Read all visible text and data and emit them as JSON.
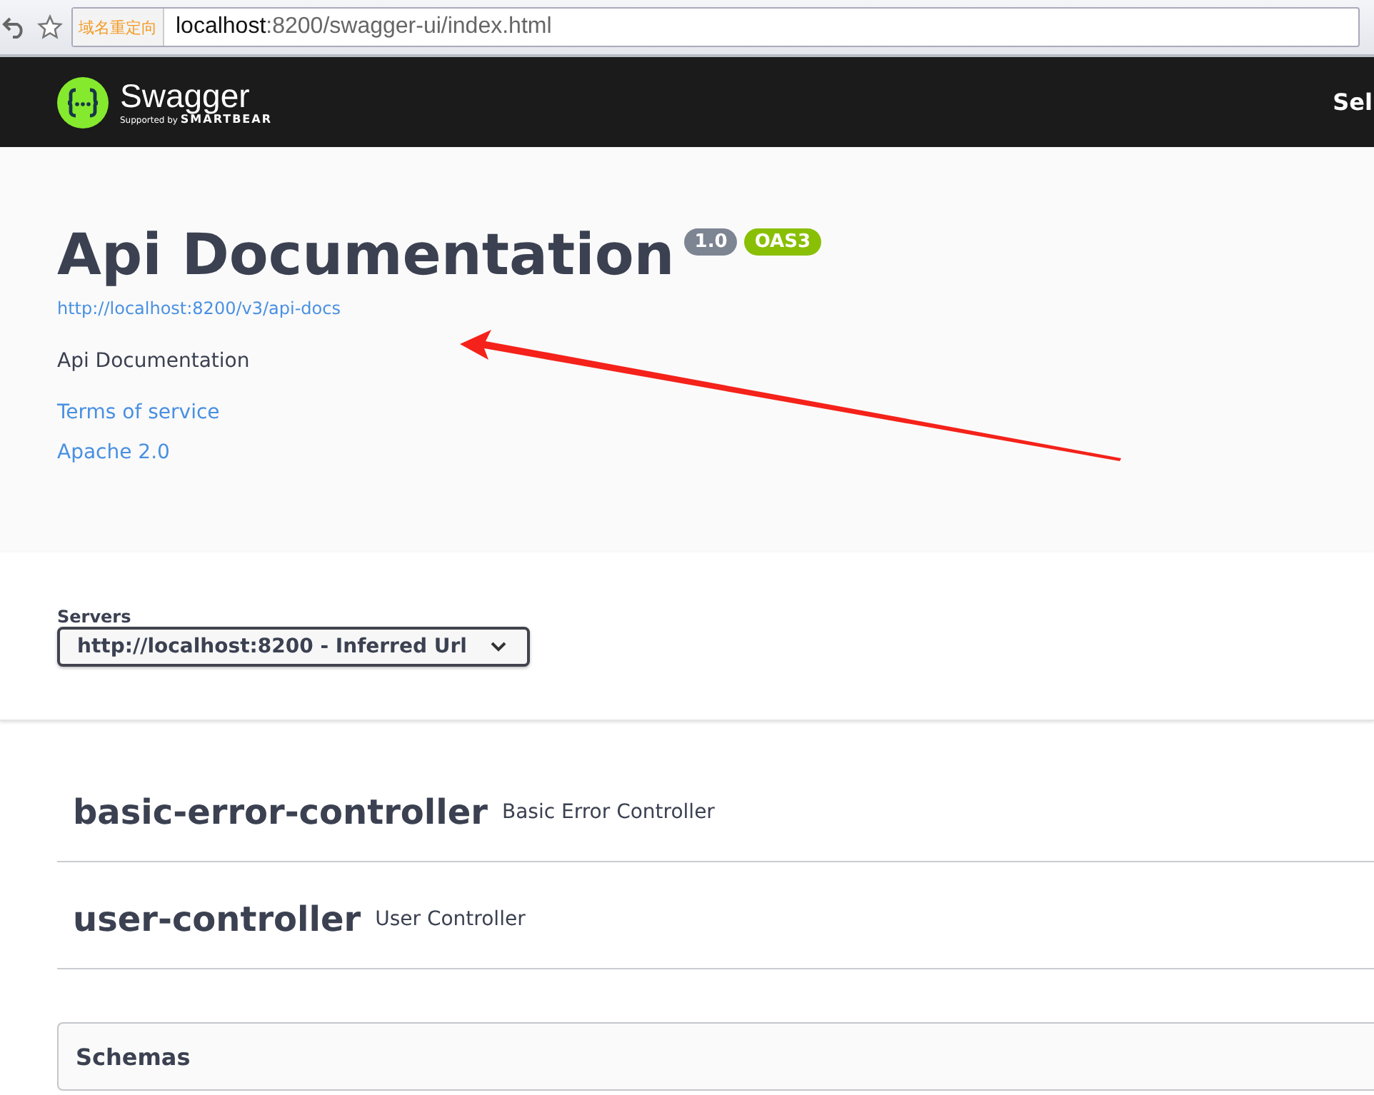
{
  "browser": {
    "redirect_badge": "域名重定向",
    "address_host": "localhost",
    "address_rest": ":8200/swagger-ui/index.html"
  },
  "topbar": {
    "logo_name": "Swagger",
    "logo_tagline_prefix": "Supported by",
    "logo_tagline_brand": "SMARTBEAR",
    "definition_label": "Sel"
  },
  "info": {
    "title": "Api Documentation",
    "version": "1.0",
    "spec_badge": "OAS3",
    "spec_url": "http://localhost:8200/v3/api-docs",
    "description": "Api Documentation",
    "links": [
      "Terms of service",
      "Apache 2.0"
    ]
  },
  "servers": {
    "label": "Servers",
    "value": "http://localhost:8200 - Inferred Url"
  },
  "tags": [
    {
      "name": "basic-error-controller",
      "description": "Basic Error Controller"
    },
    {
      "name": "user-controller",
      "description": "User Controller"
    }
  ],
  "schemas": {
    "title": "Schemas"
  }
}
